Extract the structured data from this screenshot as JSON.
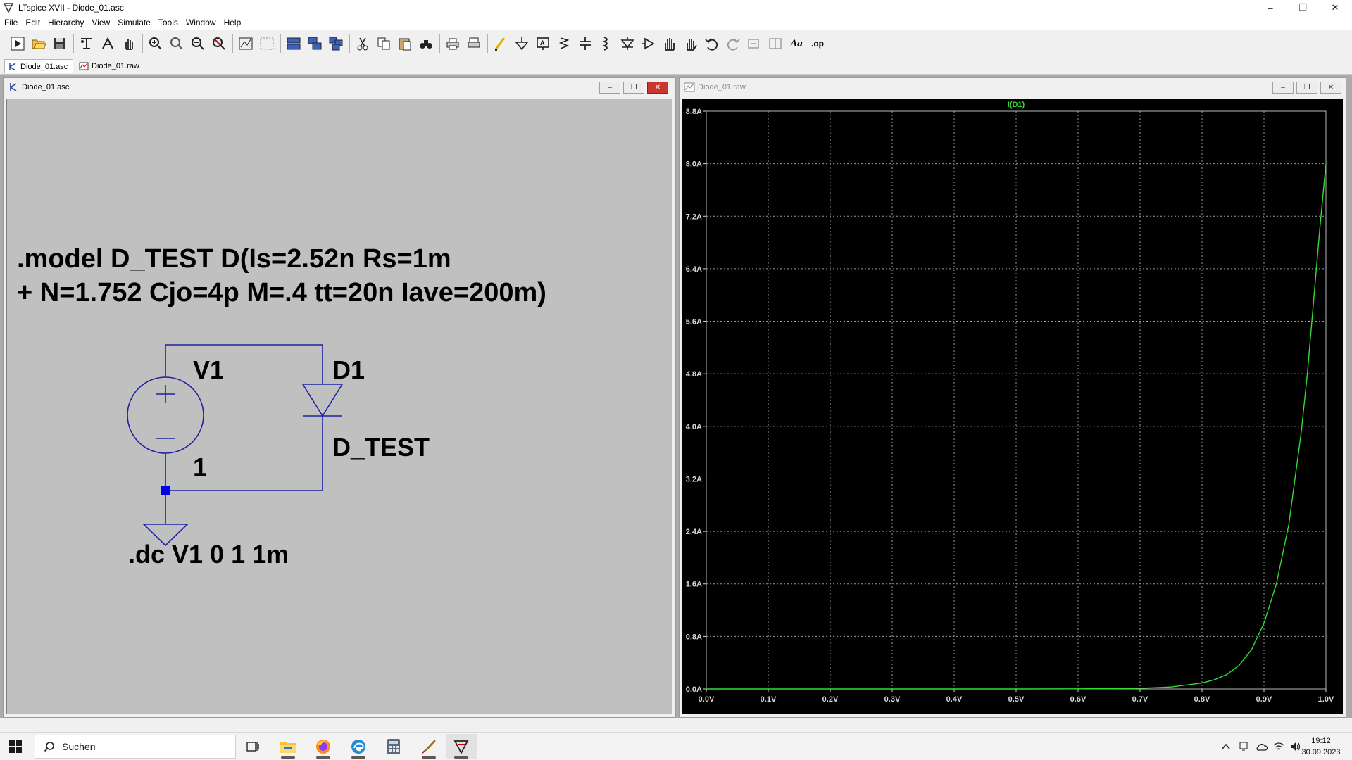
{
  "window": {
    "title": "LTspice XVII - Diode_01.asc",
    "controls": {
      "minimize": "–",
      "restore": "❐",
      "close": "✕"
    }
  },
  "menu": [
    "File",
    "Edit",
    "Hierarchy",
    "View",
    "Simulate",
    "Tools",
    "Window",
    "Help"
  ],
  "toolbar": {
    "buttons": [
      "run-icon",
      "open-icon",
      "save-icon",
      "control-panel-icon",
      "halt-icon",
      "pan-icon",
      "zoom-in-icon",
      "zoom-full-icon",
      "zoom-out-icon",
      "zoom-cancel-icon",
      "autorange-icon",
      "waveform-icon",
      "tile-horizontal-icon",
      "cascade-icon",
      "tile-vertical-icon",
      "cut-icon",
      "copy-icon",
      "paste-icon",
      "find-icon",
      "print-icon",
      "print-preview-icon",
      "draw-wire-icon",
      "ground-icon",
      "label-net-icon",
      "resistor-icon",
      "capacitor-icon",
      "inductor-icon",
      "diode-icon",
      "component-icon",
      "move-icon",
      "drag-icon",
      "undo-icon",
      "redo-icon",
      "rotate-icon",
      "mirror-icon",
      "text-icon",
      "spice-directive-icon"
    ],
    "text_label": "Aa",
    "op_label": ".op"
  },
  "tabs": [
    {
      "label": "Diode_01.asc",
      "active": true
    },
    {
      "label": "Diode_01.raw",
      "active": false
    }
  ],
  "schematic_window": {
    "title": "Diode_01.asc",
    "model_line1": ".model D_TEST D(Is=2.52n Rs=1m",
    "model_line2": "+ N=1.752 Cjo=4p M=.4 tt=20n Iave=200m)",
    "source_name": "V1",
    "source_value": "1",
    "diode_name": "D1",
    "diode_model": "D_TEST",
    "directive": ".dc V1 0 1 1m",
    "wire_color": "#2020a0",
    "background": "#c0c0c0"
  },
  "plot_window": {
    "title": "Diode_01.raw",
    "trace_color": "#33dd33",
    "axis_text_color": "#d8d8d8"
  },
  "chart_data": {
    "type": "line",
    "title": "",
    "series": [
      {
        "name": "I(D1)",
        "x": [
          0.0,
          0.5,
          0.6,
          0.65,
          0.7,
          0.75,
          0.8,
          0.82,
          0.84,
          0.86,
          0.88,
          0.9,
          0.92,
          0.94,
          0.96,
          0.97,
          0.98,
          0.99,
          1.0
        ],
        "y": [
          0.0,
          0.0,
          0.002,
          0.005,
          0.01,
          0.03,
          0.09,
          0.14,
          0.22,
          0.36,
          0.6,
          1.0,
          1.6,
          2.5,
          3.9,
          4.8,
          5.9,
          7.0,
          8.0
        ]
      }
    ],
    "xlim": [
      0.0,
      1.0
    ],
    "ylim": [
      0.0,
      8.8
    ],
    "x_ticks": [
      "0.0V",
      "0.1V",
      "0.2V",
      "0.3V",
      "0.4V",
      "0.5V",
      "0.6V",
      "0.7V",
      "0.8V",
      "0.9V",
      "1.0V"
    ],
    "y_ticks": [
      "0.0A",
      "0.8A",
      "1.6A",
      "2.4A",
      "3.2A",
      "4.0A",
      "4.8A",
      "5.6A",
      "6.4A",
      "7.2A",
      "8.0A",
      "8.8A"
    ],
    "grid": true,
    "legend": "top-center"
  },
  "taskbar": {
    "search_placeholder": "Suchen",
    "time": "19:12",
    "date": "30.09.2023",
    "apps": [
      "task-view-icon",
      "file-explorer-icon",
      "firefox-icon",
      "edge-icon",
      "calculator-icon",
      "pen-tool-icon",
      "ltspice-icon"
    ]
  }
}
